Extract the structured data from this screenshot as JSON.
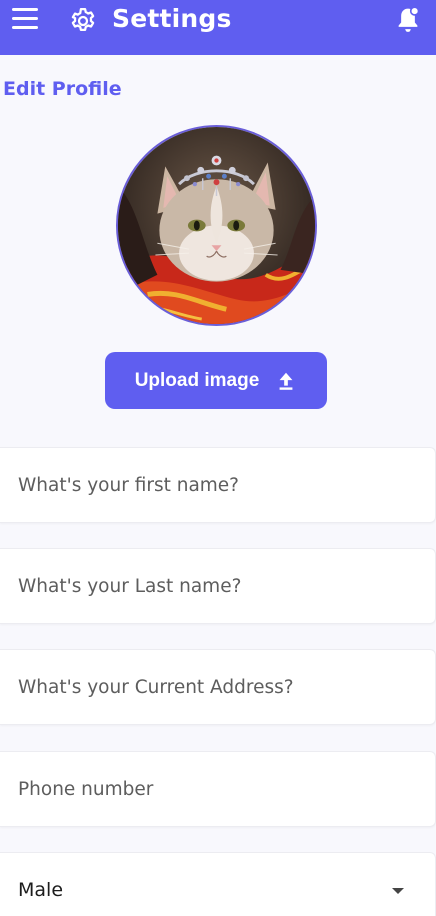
{
  "appbar": {
    "title": "Settings",
    "color": "#5f5ef0",
    "icons": [
      "menu-icon",
      "gear-icon",
      "bell-icon"
    ]
  },
  "profile": {
    "section_title": "Edit Profile",
    "upload_label": "Upload image",
    "upload_icon": "upload-icon"
  },
  "form": {
    "first_name_placeholder": "What's your first name?",
    "last_name_placeholder": "What's your Last name?",
    "address_placeholder": "What's your Current Address?",
    "phone_placeholder": "Phone number",
    "gender_value": "Male"
  }
}
